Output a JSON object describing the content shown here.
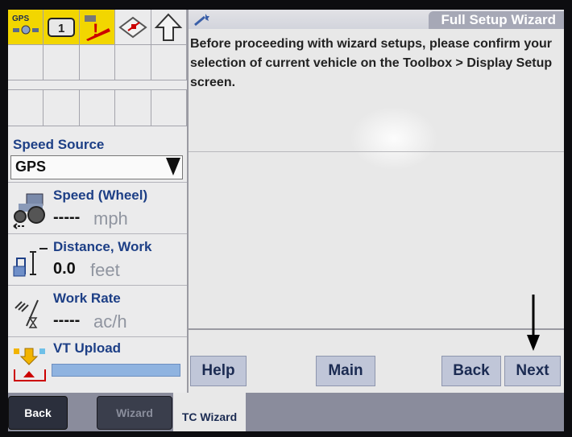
{
  "status_icons": {
    "gps_label": "GPS",
    "channel_number": "1"
  },
  "left_panel": {
    "speed_source_label": "Speed Source",
    "speed_source_value": "GPS",
    "speed": {
      "title": "Speed (Wheel)",
      "value": "-----",
      "unit": "mph"
    },
    "distance": {
      "title": "Distance, Work",
      "value": "0.0",
      "unit": "feet"
    },
    "work_rate": {
      "title": "Work Rate",
      "value": "-----",
      "unit": "ac/h"
    },
    "vt_upload": {
      "title": "VT Upload"
    }
  },
  "wizard": {
    "title": "Full Setup Wizard",
    "message": "Before proceeding with wizard setups, please confirm your selection of current vehicle on the Toolbox > Display Setup screen."
  },
  "buttons": {
    "help": "Help",
    "main": "Main",
    "back": "Back",
    "next": "Next"
  },
  "tabs": {
    "back": "Back",
    "wizard": "Wizard",
    "tc_wizard": "TC Wizard"
  },
  "colors": {
    "label_blue": "#1d3f86",
    "button_bg": "#c0c6d8",
    "title_tab": "#a6a8b6",
    "progress": "#8fb3e0"
  }
}
